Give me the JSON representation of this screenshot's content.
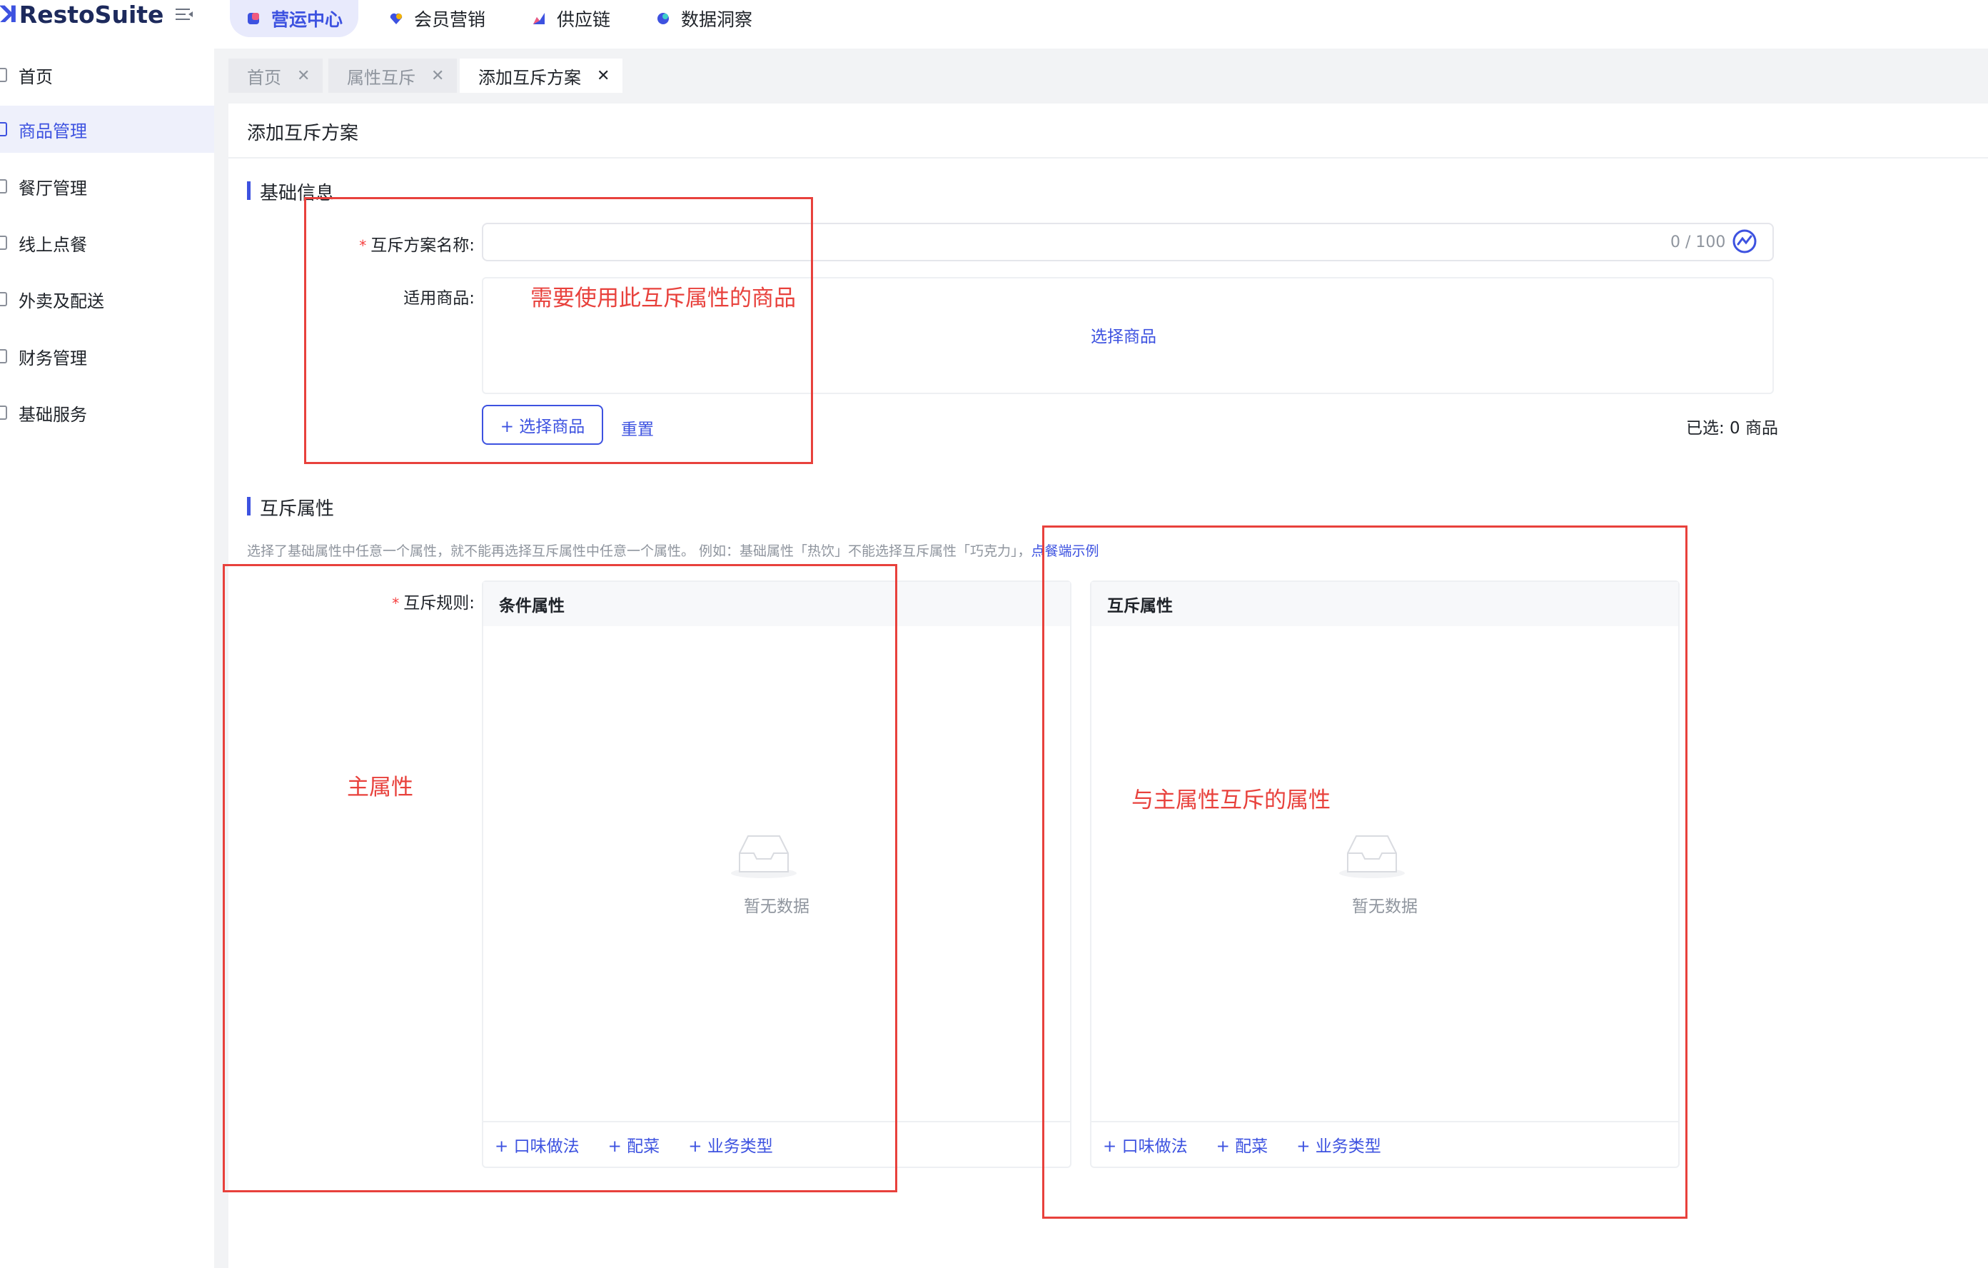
{
  "app": {
    "logo_text": "RestoSuite"
  },
  "top_nav": {
    "tabs": [
      {
        "label": "营运中心",
        "active": true,
        "icon": "cube-icon",
        "color": "#3d52e0"
      },
      {
        "label": "会员营销",
        "active": false,
        "icon": "heart-icon",
        "color": "#3d52e0"
      },
      {
        "label": "供应链",
        "active": false,
        "icon": "chart-icon",
        "color": "#3d52e0"
      },
      {
        "label": "数据洞察",
        "active": false,
        "icon": "planet-icon",
        "color": "#3d52e0"
      }
    ]
  },
  "sidebar": {
    "items": [
      {
        "label": "首页",
        "icon": "home-icon",
        "active": false
      },
      {
        "label": "商品管理",
        "icon": "goods-icon",
        "active": true
      },
      {
        "label": "餐厅管理",
        "icon": "restaurant-icon",
        "active": false
      },
      {
        "label": "线上点餐",
        "icon": "order-icon",
        "active": false
      },
      {
        "label": "外卖及配送",
        "icon": "delivery-icon",
        "active": false
      },
      {
        "label": "财务管理",
        "icon": "finance-icon",
        "active": false
      },
      {
        "label": "基础服务",
        "icon": "service-icon",
        "active": false
      }
    ]
  },
  "page_tabs": [
    {
      "label": "首页",
      "active": false
    },
    {
      "label": "属性互斥",
      "active": false
    },
    {
      "label": "添加互斥方案",
      "active": true
    }
  ],
  "page": {
    "title": "添加互斥方案",
    "basic_section": {
      "title": "基础信息",
      "name_label": "互斥方案名称:",
      "name_value": "",
      "name_counter": "0 / 100",
      "goods_label": "适用商品:",
      "goods_link": "选择商品",
      "select_button": "+ 选择商品",
      "reset_link": "重置",
      "selected_count": "已选: 0 商品"
    },
    "mutex_section": {
      "title": "互斥属性",
      "hint": "选择了基础属性中任意一个属性，就不能再选择互斥属性中任意一个属性。 例如：基础属性「热饮」不能选择互斥属性「巧克力」，",
      "hint_link": "点餐端示例",
      "rule_label": "互斥规则:",
      "condition_panel": {
        "title": "条件属性",
        "empty_text": "暂无数据",
        "actions": [
          "+ 口味做法",
          "+ 配菜",
          "+ 业务类型"
        ]
      },
      "mutex_panel": {
        "title": "互斥属性",
        "empty_text": "暂无数据",
        "actions": [
          "+ 口味做法",
          "+ 配菜",
          "+ 业务类型"
        ]
      }
    }
  },
  "annotations": {
    "goods_note": "需要使用此互斥属性的商品",
    "main_attr_note": "主属性",
    "mutex_attr_note": "与主属性互斥的属性",
    "color": "#e8413c"
  }
}
